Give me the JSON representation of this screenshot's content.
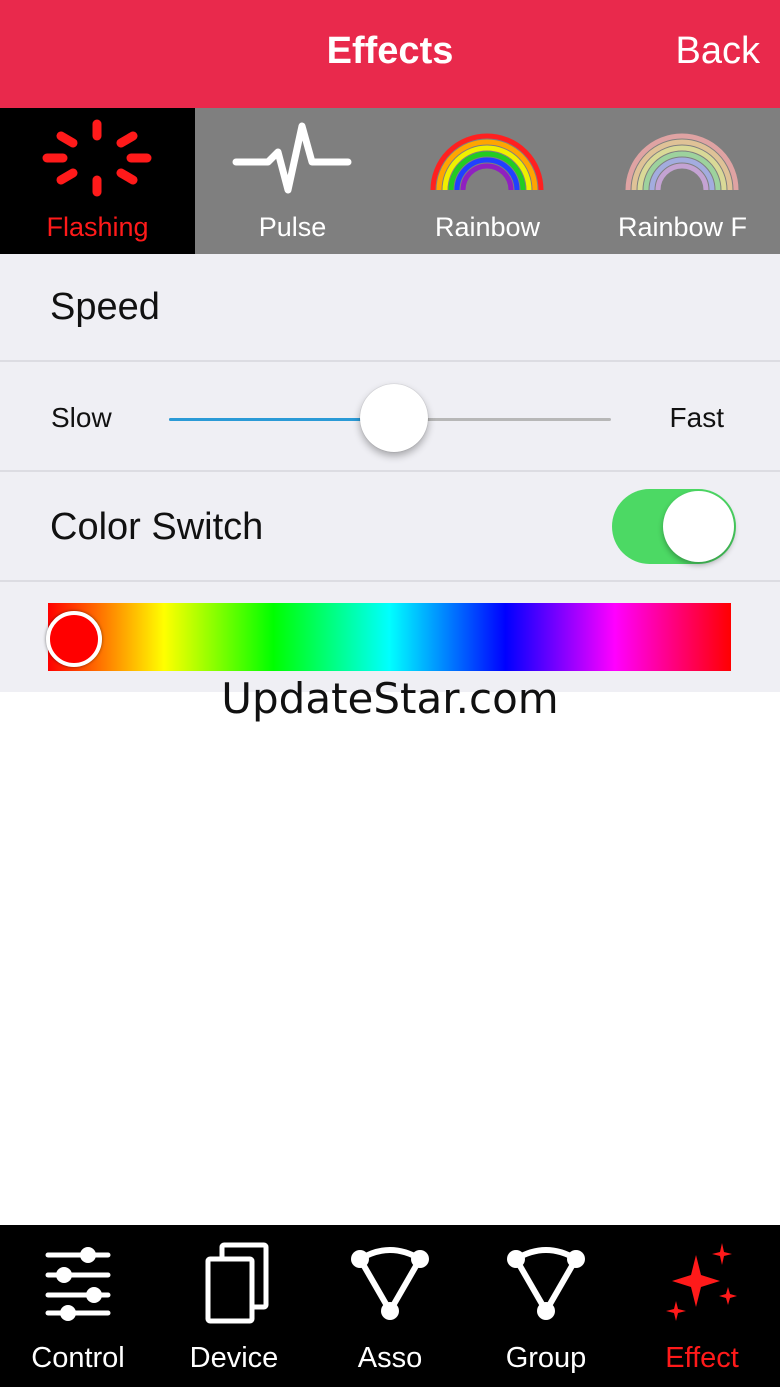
{
  "nav": {
    "title": "Effects",
    "back_label": "Back",
    "color": "#e9294c"
  },
  "effect_tabs": [
    {
      "label": "Flashing",
      "icon": "flashing-icon",
      "active": true
    },
    {
      "label": "Pulse",
      "icon": "pulse-icon",
      "active": false
    },
    {
      "label": "Rainbow",
      "icon": "rainbow-icon",
      "active": false
    },
    {
      "label": "Rainbow F",
      "icon": "rainbow-fade-icon",
      "active": false
    }
  ],
  "speed": {
    "title": "Speed",
    "min_label": "Slow",
    "max_label": "Fast",
    "value": 0.51
  },
  "color_switch": {
    "label": "Color Switch",
    "on": true,
    "on_color": "#4cd964"
  },
  "color_picker": {
    "selected_color": "#ff0000",
    "position": 0.03
  },
  "watermark": "UpdateStar.com",
  "tab_bar": [
    {
      "label": "Control",
      "icon": "sliders-icon",
      "active": false
    },
    {
      "label": "Device",
      "icon": "device-icon",
      "active": false
    },
    {
      "label": "Asso",
      "icon": "asso-icon",
      "active": false
    },
    {
      "label": "Group",
      "icon": "group-icon",
      "active": false
    },
    {
      "label": "Effect",
      "icon": "sparkle-icon",
      "active": true
    }
  ],
  "accent_color": "#ff1a1a"
}
